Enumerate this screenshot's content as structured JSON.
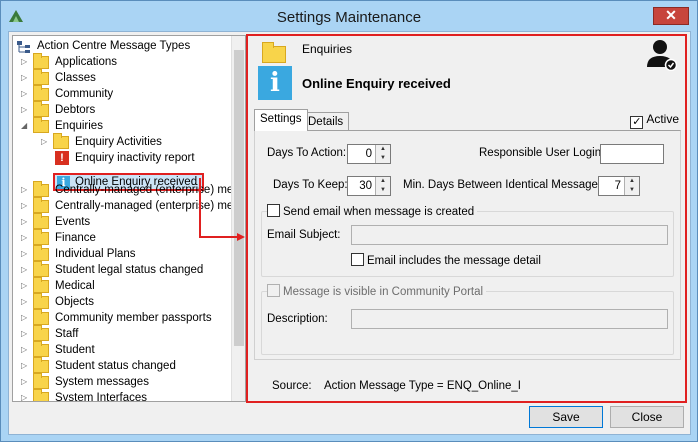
{
  "window": {
    "title": "Settings Maintenance",
    "close_glyph": "✕"
  },
  "tree": {
    "root": "Action Centre Message Types",
    "items": [
      {
        "label": "Applications"
      },
      {
        "label": "Classes"
      },
      {
        "label": "Community"
      },
      {
        "label": "Debtors"
      },
      {
        "label": "Enquiries"
      },
      {
        "label": "Enquiry Activities"
      },
      {
        "label": "Enquiry inactivity report"
      },
      {
        "label": "Online Enquiry received"
      },
      {
        "label": "Centrally-managed (enterprise) mess"
      },
      {
        "label": "Centrally-managed (enterprise) mess"
      },
      {
        "label": "Events"
      },
      {
        "label": "Finance"
      },
      {
        "label": "Individual Plans"
      },
      {
        "label": "Student legal status changed"
      },
      {
        "label": "Medical"
      },
      {
        "label": "Objects"
      },
      {
        "label": "Community member passports"
      },
      {
        "label": "Staff"
      },
      {
        "label": "Student"
      },
      {
        "label": "Student status changed"
      },
      {
        "label": "System messages"
      },
      {
        "label": "System Interfaces"
      }
    ]
  },
  "detail": {
    "category": "Enquiries",
    "message_title": "Online Enquiry received",
    "tabs": [
      "Settings",
      "Details"
    ],
    "active_label": "Active",
    "active_checked": true,
    "days_to_action_label": "Days To Action:",
    "days_to_action": "0",
    "responsible_user_label": "Responsible User Login:",
    "responsible_user": "",
    "days_to_keep_label": "Days To Keep:",
    "days_to_keep": "30",
    "min_days_label": "Min. Days Between Identical Messages:",
    "min_days": "7",
    "send_email_label": "Send email when message is created",
    "email_subject_label": "Email Subject:",
    "email_subject": "",
    "email_detail_label": "Email includes the message detail",
    "portal_label": "Message is visible in Community Portal",
    "description_label": "Description:",
    "description": "",
    "source_label": "Source:",
    "source_value": "Action Message Type = ENQ_Online_I"
  },
  "buttons": {
    "save": "Save",
    "close": "Close"
  },
  "colors": {
    "highlight": "#e02020",
    "titlebar": "#aad4f4",
    "info": "#3aa8e0",
    "folder": "#f8d44a"
  }
}
